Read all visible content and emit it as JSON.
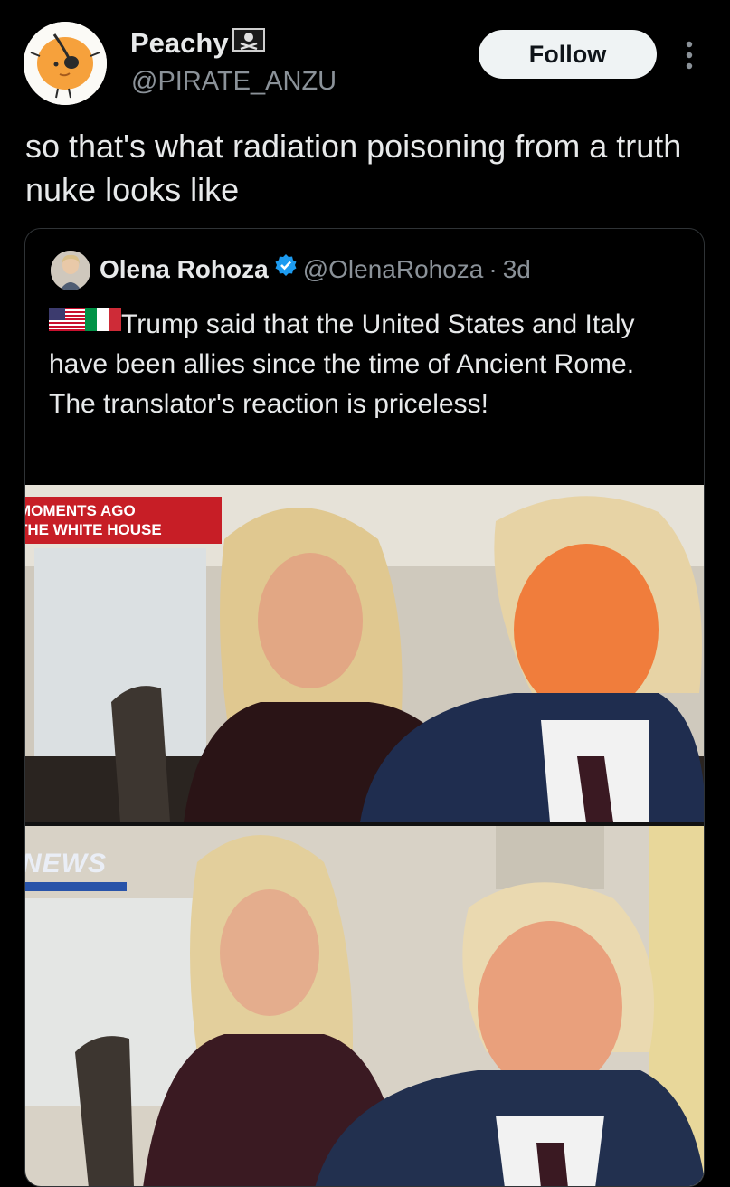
{
  "post": {
    "author": {
      "name": "Peachy",
      "handle": "@PIRATE_ANZU",
      "avatar_icon": "peach-pirate-avatar-icon",
      "name_badge_icon": "pirate-flag-icon"
    },
    "follow_label": "Follow",
    "more_icon": "more-vertical-icon",
    "text": "so that's what radiation poisoning from a truth nuke looks like"
  },
  "quote": {
    "author": {
      "name": "Olena Rohoza",
      "handle": "@OlenaRohoza",
      "separator": "·",
      "time": "3d",
      "verified_icon": "verified-badge-icon",
      "verified_color": "#1d9bf0"
    },
    "flags": [
      "us-flag-icon",
      "italy-flag-icon"
    ],
    "text": "Trump said that the United States and Italy have been allies since the time of Ancient Rome. The translator's reaction is priceless!",
    "media": {
      "top_chyron_line1": "MOMENTS AGO",
      "top_chyron_line2": "THE WHITE HOUSE",
      "bottom_logo": "NEWS"
    }
  },
  "colors": {
    "background": "#000000",
    "text_primary": "#e7e9ea",
    "text_secondary": "#8b9299",
    "border": "#2f3336",
    "button_bg": "#eff3f4",
    "chyron_red": "#c71e26"
  }
}
